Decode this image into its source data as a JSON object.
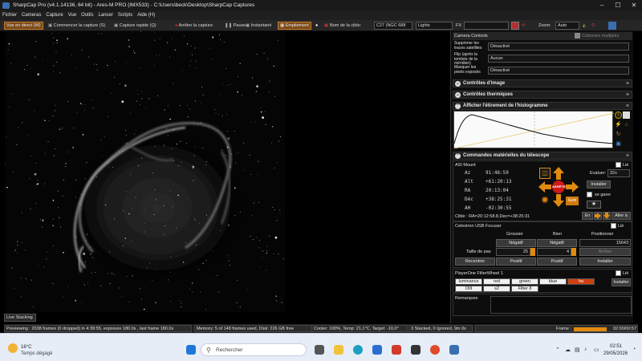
{
  "window": {
    "title": "SharpCap Pro (v4.1.14136, 64 bit) - Ares-M PRO (IMX533) - C:\\Users\\beck\\Desktop\\SharpCap Captures",
    "minimize": "–",
    "maximize": "☐",
    "close": "✕"
  },
  "menu": [
    "Fichier",
    "Cameras",
    "Capture",
    "Vue",
    "Outils",
    "Lancer",
    "Scripts",
    "Aide (H)"
  ],
  "toolbar": {
    "live": "Vue en direct (W)",
    "start_capture": "Commencer la capture (S)",
    "quick_capture": "Capture rapide (Q)",
    "stop_capture": "Arrêter la capture",
    "pause": "Pause",
    "snapshot": "Instantané",
    "stack": "Empilement",
    "target_label": "Nom de la cible:",
    "target_value": "C27 (NGC 688",
    "frame_type": "Lights",
    "fx_label": "FX",
    "zoom_label": "Zoom:",
    "zoom_value": "Auto"
  },
  "camera_controls": {
    "title": "Camera Controls",
    "multi_columns": "Colonnes multiples",
    "rows": [
      {
        "label": "Supprimer les traces satellites",
        "value": "Désactivé"
      },
      {
        "label": "Flip (après la tombée de la méridien)",
        "value": "Aucun"
      },
      {
        "label": "Masquer les pixels exposés",
        "value": "Désactivé"
      }
    ]
  },
  "sections": {
    "image_controls": "Contrôles d'image",
    "thermal_controls": "Contrôles thermiques",
    "histogram": "Afficher l'étirement de l'histogramme",
    "telescope": "Commandes matérielles du télescope"
  },
  "mount": {
    "name": "ASI Mount",
    "linked_label": "Lié",
    "coords": [
      {
        "key": "Az",
        "value": "91:46:59"
      },
      {
        "key": "Alt",
        "value": "+61:20:13"
      },
      {
        "key": "RA",
        "value": "20:13:04"
      },
      {
        "key": "Déc",
        "value": "+38:25:31"
      },
      {
        "key": "AH",
        "value": "-02:30:55"
      }
    ],
    "stop_label": "ARRÊTER",
    "evaluate_label": "Evaluer:",
    "speed": "32x",
    "install": "Installer",
    "park": "se garer",
    "suivi": "Suivi",
    "target_line": "Cible : RA=20:12:58.8,Dec=+38:25:31",
    "goto_label": "Aller à",
    "err_label": "Err"
  },
  "focuser": {
    "name": "Celestron USB Focuser",
    "linked_label": "Lié",
    "coarse": "Grossier",
    "fine": "Bien",
    "position_label": "Positionner",
    "negative1": "Négatif",
    "negative2": "Négatif",
    "position_value": "15643",
    "step_label": "Taille de pas",
    "step_coarse": "25",
    "step_fine": "4",
    "stop": "Arrêter",
    "recenter": "Recentrer",
    "positive1": "Positif",
    "positive2": "Positif",
    "install": "Installer"
  },
  "filterwheel": {
    "name": "PlayerOne FilterWheel 1",
    "linked_label": "Lié",
    "row1": [
      "luminance",
      "red",
      "green",
      "blue",
      "ha"
    ],
    "row2": [
      "OIII",
      "s2",
      "Filter 8"
    ],
    "selected": "ha",
    "install": "Installer"
  },
  "remarks_label": "Remarques",
  "live_stacking_tab": "Live Stacking",
  "status": {
    "preview": "Previewing : 2038 frames (0 dropped) in 4:39:55, exposure 180.0s , last frame 180.0s",
    "memory": "Memory: 5 of 148 frames used, Disk: 226 GB free",
    "cooler": "Cooler: 100%, Temp: 21,1°C, Target: -10,0°",
    "stacked": "3 Stacked, 0 Ignored, 9m 0s",
    "frame_label": "Frame :",
    "frame_progress": 0.9,
    "frame_time": "02:00/00:57"
  },
  "taskbar": {
    "weather_temp": "16°C",
    "weather_desc": "Temps dégagé",
    "search_placeholder": "Rechercher",
    "time": "02:51",
    "date": "29/05/2026"
  }
}
